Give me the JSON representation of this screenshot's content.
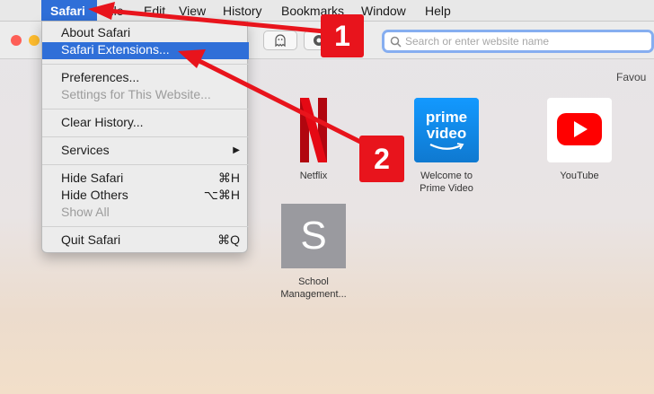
{
  "menubar": {
    "apple": "",
    "app": "Safari",
    "items": [
      "File",
      "Edit",
      "View",
      "History",
      "Bookmarks",
      "Window",
      "Help"
    ]
  },
  "toolbar": {
    "address_placeholder": "Search or enter website name"
  },
  "favourites": {
    "header": "Favou",
    "tiles": [
      {
        "label": "Netflix",
        "icon": "netflix-logo"
      },
      {
        "label_line1": "Welcome to",
        "label_line2": "Prime Video",
        "icon": "prime-video-logo",
        "logo_text_1": "prime",
        "logo_text_2": "video"
      },
      {
        "label": "YouTube",
        "icon": "youtube-logo"
      },
      {
        "label_line1": "School",
        "label_line2": "Management...",
        "icon_letter": "S"
      }
    ]
  },
  "safari_menu": {
    "about": "About Safari",
    "extensions": "Safari Extensions...",
    "preferences": "Preferences...",
    "settings_site": "Settings for This Website...",
    "clear_history": "Clear History...",
    "services": "Services",
    "services_arrow": "▶",
    "hide_safari": "Hide Safari",
    "hide_safari_shortcut": "⌘H",
    "hide_others": "Hide Others",
    "hide_others_shortcut": "⌥⌘H",
    "show_all": "Show All",
    "quit": "Quit Safari",
    "quit_shortcut": "⌘Q"
  },
  "annotations": {
    "step1": "1",
    "step2": "2",
    "color": "#e8141c"
  }
}
